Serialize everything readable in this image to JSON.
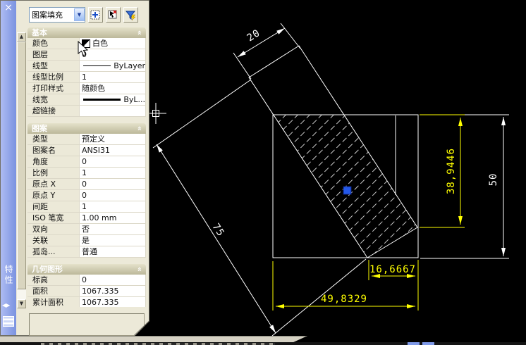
{
  "palette": {
    "title": "特性",
    "selector_value": "图案填充",
    "toolbar_icons": [
      "pickadd-toggle-icon",
      "select-objects-icon",
      "quick-select-icon"
    ],
    "sections": [
      {
        "title": "基本",
        "rows": [
          {
            "label": "颜色",
            "value": "白色",
            "adorn": "swatch"
          },
          {
            "label": "图层",
            "value": "0"
          },
          {
            "label": "线型",
            "value": "ByLayer",
            "adorn": "line"
          },
          {
            "label": "线型比例",
            "value": "1"
          },
          {
            "label": "打印样式",
            "value": "随颜色"
          },
          {
            "label": "线宽",
            "value": "ByL...",
            "adorn": "thickline"
          },
          {
            "label": "超链接",
            "value": ""
          }
        ]
      },
      {
        "title": "图案",
        "rows": [
          {
            "label": "类型",
            "value": "预定义"
          },
          {
            "label": "图案名",
            "value": "ANSI31"
          },
          {
            "label": "角度",
            "value": "0"
          },
          {
            "label": "比例",
            "value": "1"
          },
          {
            "label": "原点 X",
            "value": "0"
          },
          {
            "label": "原点 Y",
            "value": "0"
          },
          {
            "label": "间距",
            "value": "1"
          },
          {
            "label": "ISO 笔宽",
            "value": "1.00 mm"
          },
          {
            "label": "双向",
            "value": "否"
          },
          {
            "label": "关联",
            "value": "是"
          },
          {
            "label": "孤岛...",
            "value": "普通"
          }
        ]
      },
      {
        "title": "几何图形",
        "rows": [
          {
            "label": "标高",
            "value": "0"
          },
          {
            "label": "面积",
            "value": "1067.335"
          },
          {
            "label": "累计面积",
            "value": "1067.335"
          }
        ]
      }
    ]
  },
  "drawing": {
    "dims": {
      "top": "20",
      "left": "75",
      "right_inner": "38,9446",
      "right_outer": "50",
      "bottom_inner": "16,6667",
      "bottom_outer": "49,8329"
    },
    "colors": {
      "background": "#000000",
      "geometry": "#ffffff",
      "selected_dim": "#ffff00",
      "grip": "#2458e8"
    }
  }
}
